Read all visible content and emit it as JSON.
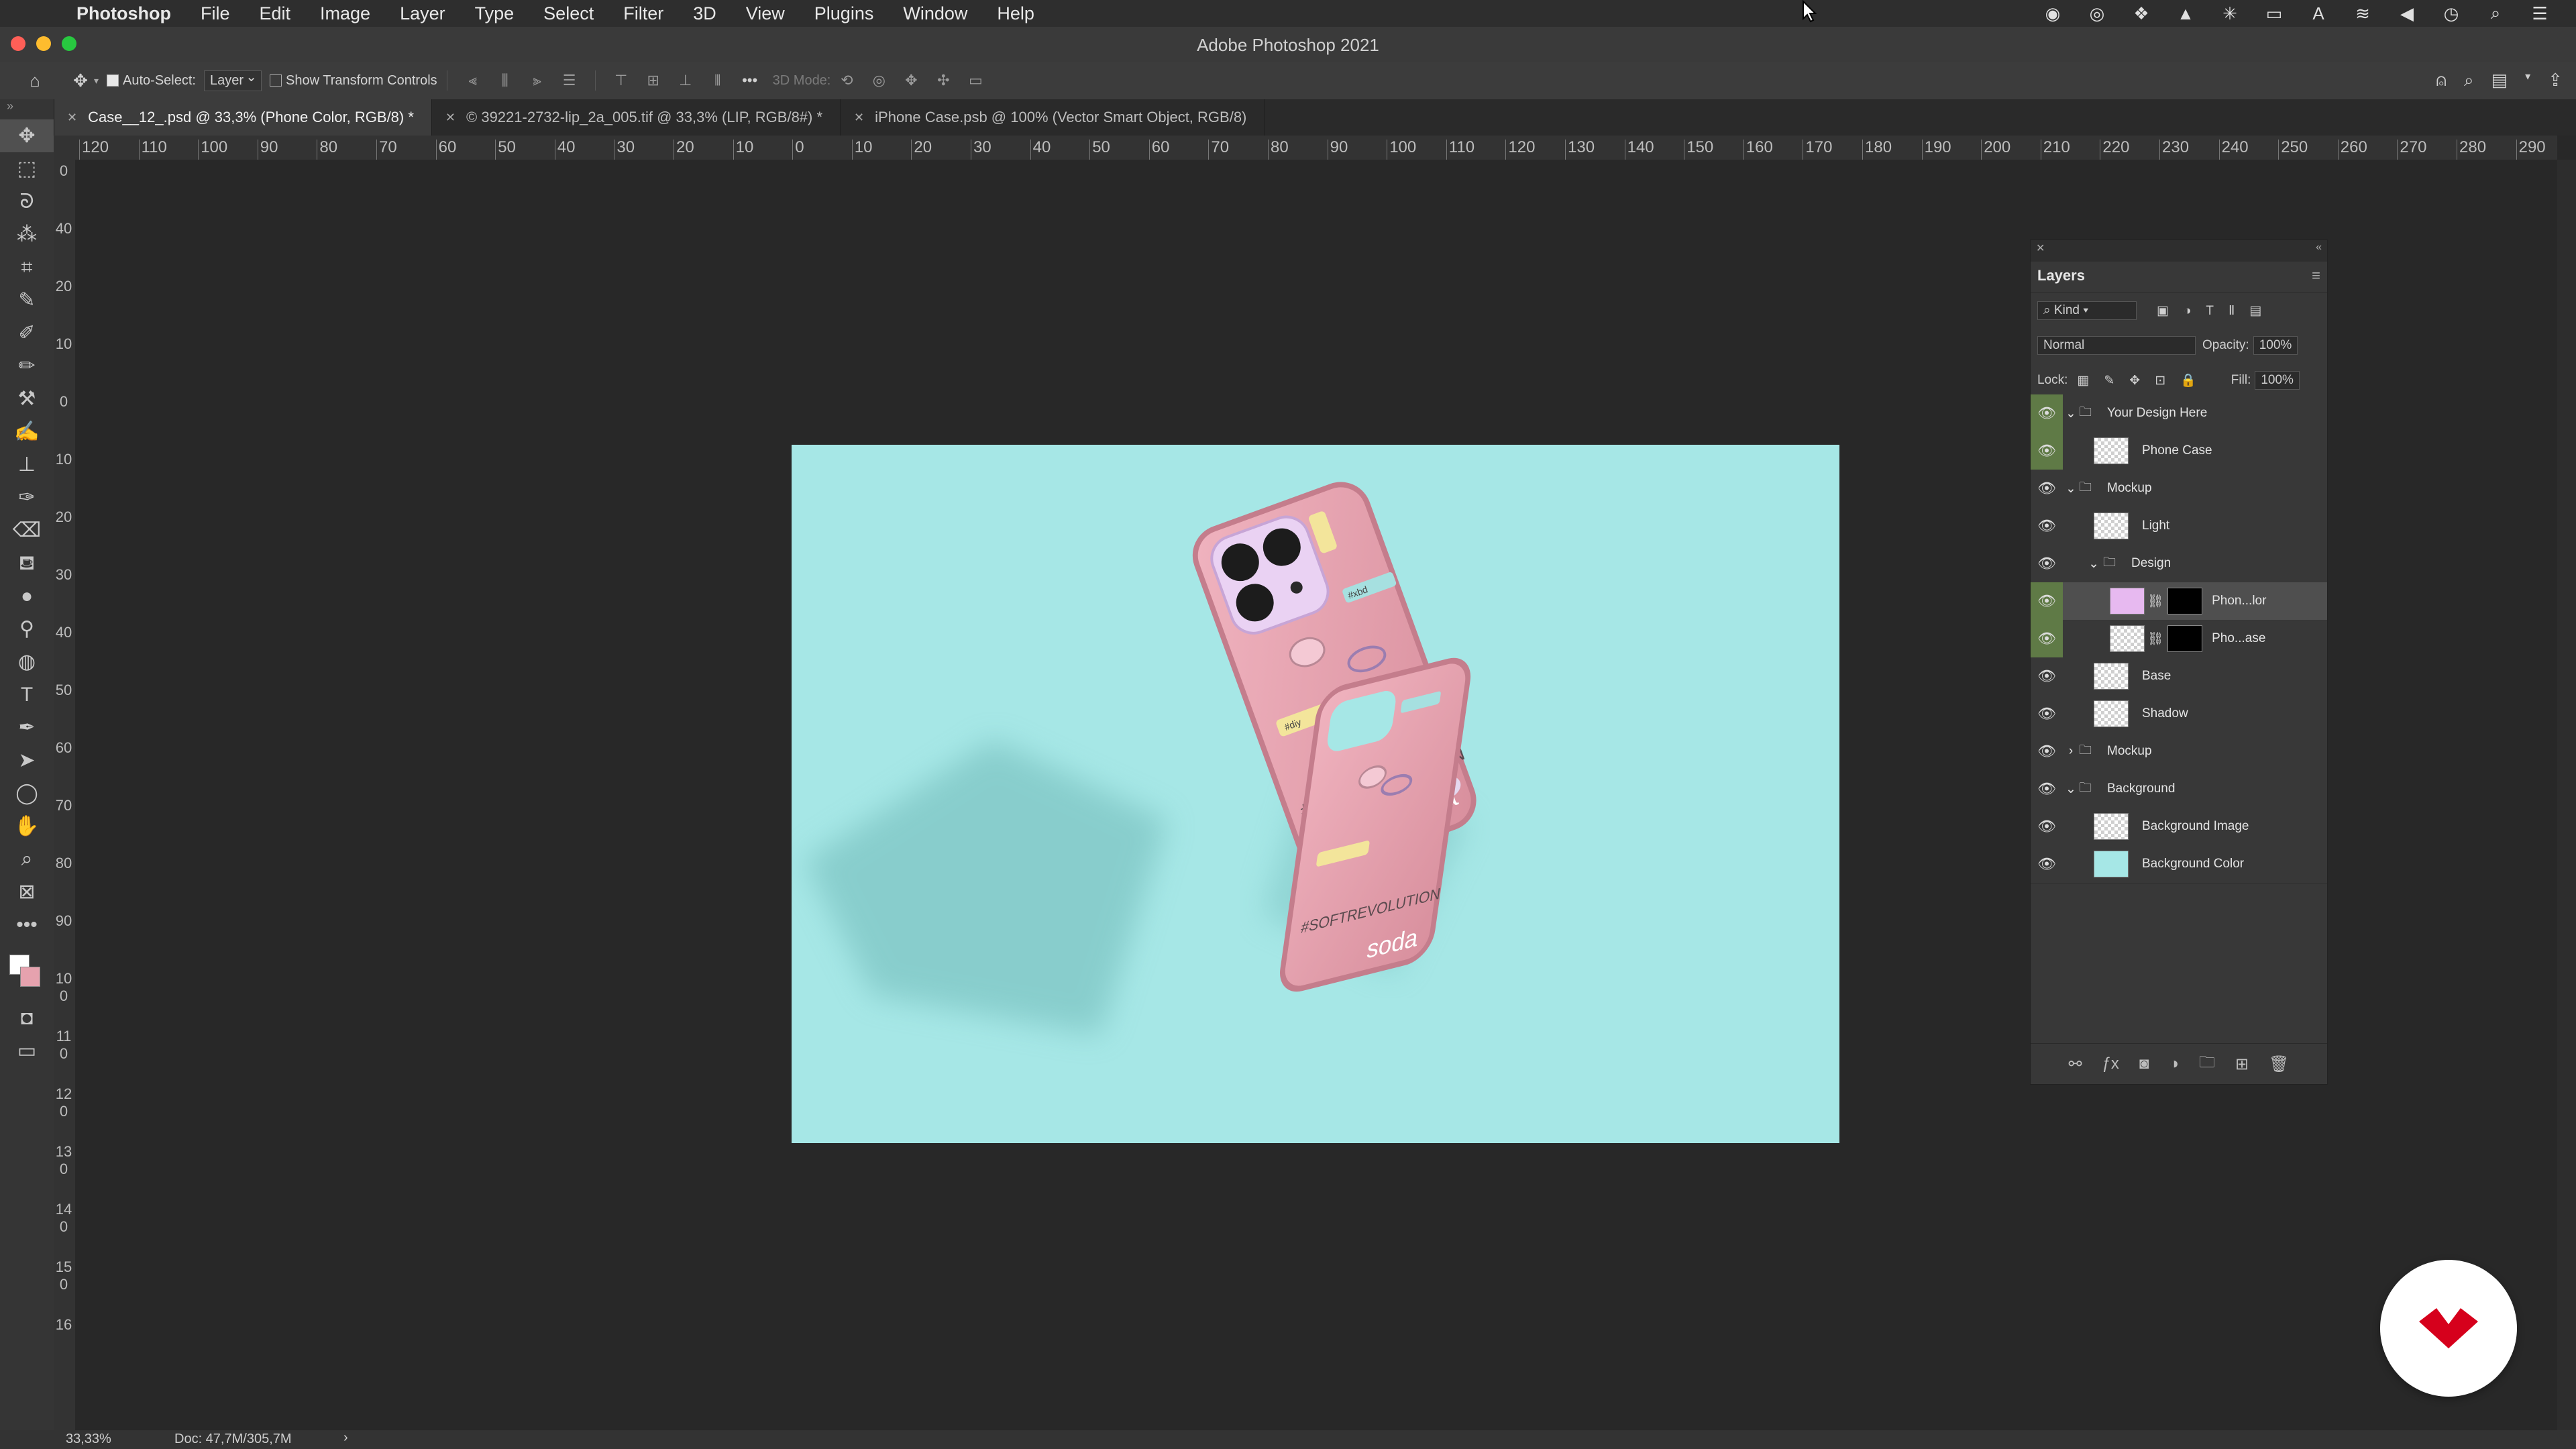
{
  "menubar": {
    "app": "Photoshop",
    "items": [
      "File",
      "Edit",
      "Image",
      "Layer",
      "Type",
      "Select",
      "Filter",
      "3D",
      "View",
      "Plugins",
      "Window",
      "Help"
    ]
  },
  "window": {
    "title": "Adobe Photoshop 2021"
  },
  "options": {
    "auto_select_label": "Auto-Select:",
    "auto_select_value": "Layer",
    "show_transform_label": "Show Transform Controls",
    "mode_3d_label": "3D Mode:"
  },
  "tabs": [
    {
      "label": "Case__12_.psd @ 33,3% (Phone Color, RGB/8) *"
    },
    {
      "label": "© 39221-2732-lip_2a_005.tif @ 33,3% (LIP, RGB/8#) *"
    },
    {
      "label": "iPhone Case.psb @ 100% (Vector Smart Object, RGB/8)"
    }
  ],
  "ruler": {
    "h_labels": [
      "120",
      "110",
      "100",
      "90",
      "80",
      "70",
      "60",
      "50",
      "40",
      "30",
      "20",
      "10",
      "0",
      "10",
      "20",
      "30",
      "40",
      "50",
      "60",
      "70",
      "80",
      "90",
      "100",
      "110",
      "120",
      "130",
      "140",
      "150",
      "160",
      "170",
      "180",
      "190",
      "200",
      "210",
      "220",
      "230",
      "240",
      "250",
      "260",
      "270",
      "280",
      "290"
    ],
    "v_labels": [
      "0",
      "40",
      "20",
      "10",
      "0",
      "10",
      "20",
      "30",
      "40",
      "50",
      "60",
      "70",
      "80",
      "90",
      "100",
      "110",
      "120",
      "130",
      "140",
      "150",
      "16"
    ]
  },
  "artwork": {
    "slogan": "#SOFTREVOLUTION",
    "brand": "soda",
    "tag_front": "#xbd",
    "tag_day": "#diy"
  },
  "layers_panel": {
    "title": "Layers",
    "filter_kind": "Kind",
    "blend_mode": "Normal",
    "opacity_label": "Opacity:",
    "opacity_value": "100%",
    "lock_label": "Lock:",
    "fill_label": "Fill:",
    "fill_value": "100%",
    "layers": [
      {
        "name": "Your Design Here"
      },
      {
        "name": "Phone Case"
      },
      {
        "name": "Mockup"
      },
      {
        "name": "Light"
      },
      {
        "name": "Design"
      },
      {
        "name": "Phon...lor"
      },
      {
        "name": "Pho...ase"
      },
      {
        "name": "Base"
      },
      {
        "name": "Shadow"
      },
      {
        "name": "Mockup"
      },
      {
        "name": "Background"
      },
      {
        "name": "Background Image"
      },
      {
        "name": "Background Color"
      }
    ]
  },
  "status": {
    "zoom": "33,33%",
    "doc": "Doc: 47,7M/305,7M"
  },
  "colors": {
    "canvas_bg": "#a6e7e6",
    "case_pink": "#e6a2ae",
    "visibility_green": "#5f7a46",
    "logo_red": "#d6001c"
  }
}
